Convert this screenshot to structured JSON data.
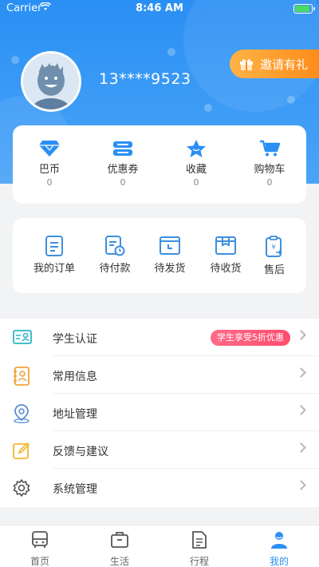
{
  "status_bar": {
    "carrier": "Carrier",
    "time": "8:46 AM"
  },
  "profile": {
    "phone": "13****9523"
  },
  "invite": {
    "label": "邀请有礼"
  },
  "assets": [
    {
      "label": "巴币",
      "value": "0",
      "icon": "diamond-icon"
    },
    {
      "label": "优惠券",
      "value": "0",
      "icon": "coupon-icon"
    },
    {
      "label": "收藏",
      "value": "0",
      "icon": "star-icon"
    },
    {
      "label": "购物车",
      "value": "0",
      "icon": "cart-icon"
    }
  ],
  "orders": [
    {
      "label": "我的订单",
      "icon": "order-list-icon"
    },
    {
      "label": "待付款",
      "icon": "pending-payment-icon"
    },
    {
      "label": "待发货",
      "icon": "pending-shipment-icon"
    },
    {
      "label": "待收货",
      "icon": "pending-receipt-icon"
    },
    {
      "label": "售后",
      "icon": "after-sales-icon"
    }
  ],
  "menu": [
    {
      "label": "学生认证",
      "badge": "学生享受5折优惠",
      "icon": "student-card-icon"
    },
    {
      "label": "常用信息",
      "icon": "contacts-book-icon"
    },
    {
      "label": "地址管理",
      "icon": "location-pin-icon"
    },
    {
      "label": "反馈与建议",
      "icon": "edit-note-icon"
    },
    {
      "label": "系统管理",
      "icon": "settings-gear-icon"
    }
  ],
  "tabs": [
    {
      "label": "首页",
      "icon": "bus-icon"
    },
    {
      "label": "生活",
      "icon": "briefcase-icon"
    },
    {
      "label": "行程",
      "icon": "document-icon"
    },
    {
      "label": "我的",
      "icon": "user-icon",
      "active": true
    }
  ],
  "colors": {
    "primary": "#2a8ff4",
    "accent_orange": "#ff8c1a",
    "badge_pink": "#ff4d6d"
  }
}
